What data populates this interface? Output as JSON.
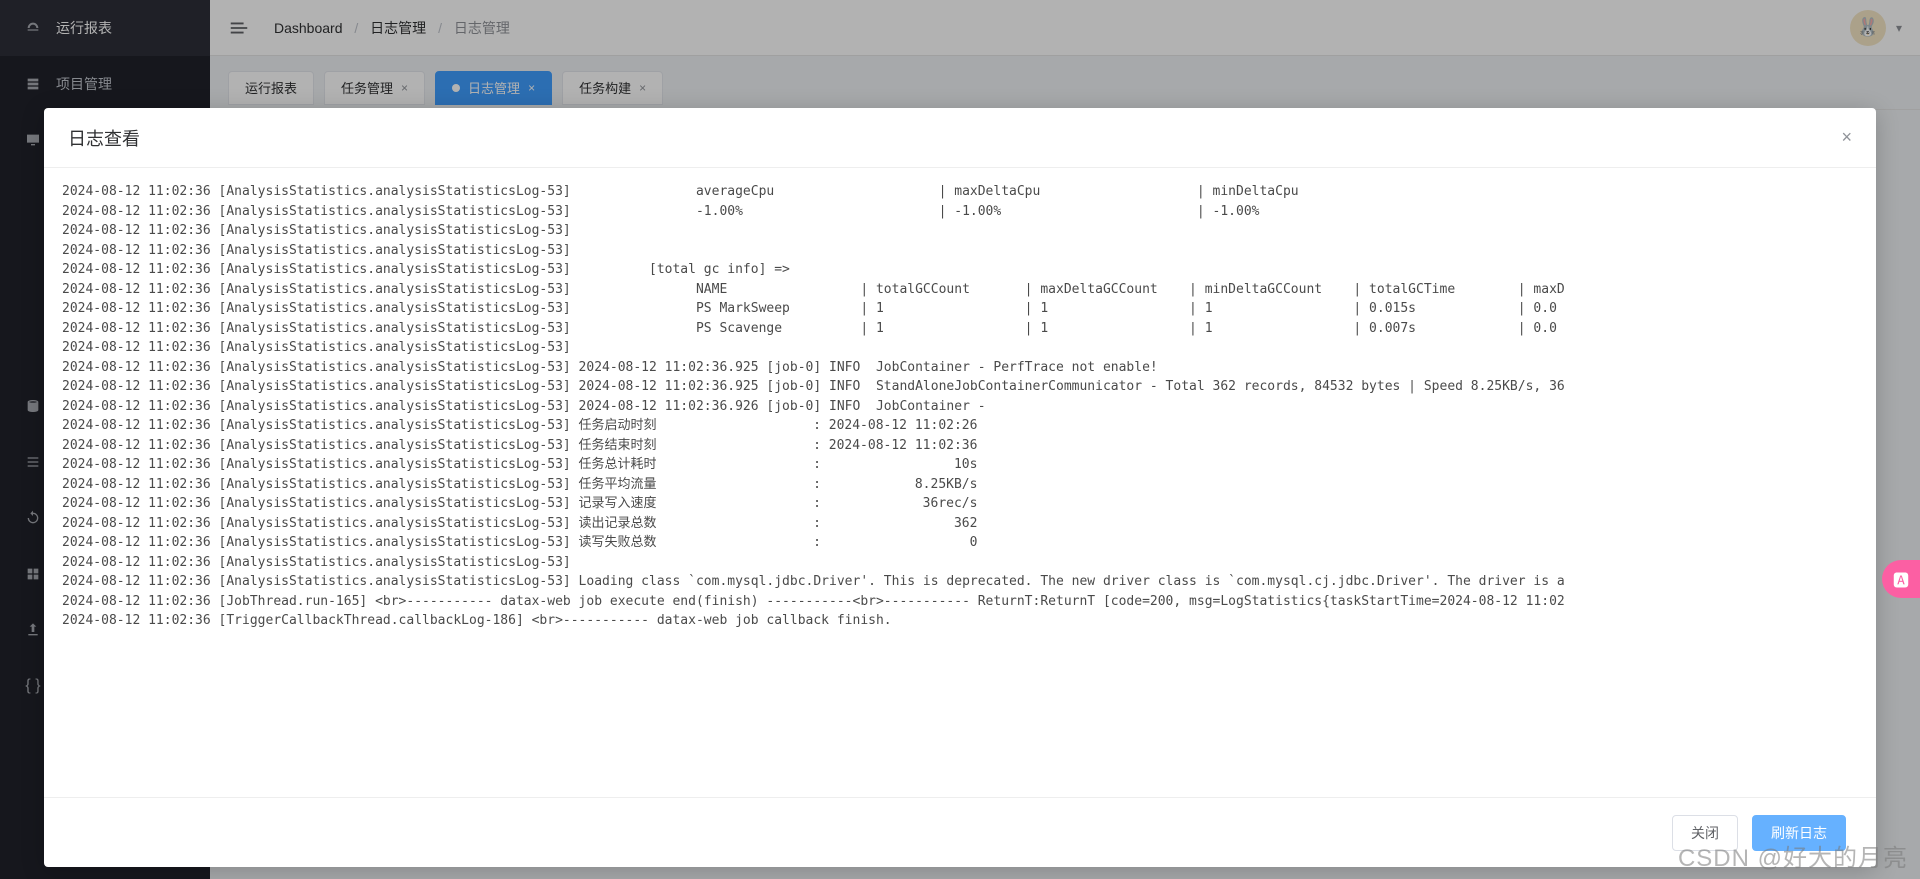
{
  "sidebar": {
    "items": [
      {
        "label": "运行报表",
        "icon": "dashboard-icon"
      },
      {
        "label": "项目管理",
        "icon": "project-icon"
      },
      {
        "label": "",
        "icon": "screen-icon"
      },
      {
        "label": "",
        "icon": "database-icon"
      },
      {
        "label": "",
        "icon": "list-icon"
      },
      {
        "label": "",
        "icon": "sync-icon"
      },
      {
        "label": "",
        "icon": "grid-icon"
      },
      {
        "label": "",
        "icon": "export-icon"
      },
      {
        "label": "",
        "icon": "braces-icon"
      }
    ]
  },
  "topbar": {
    "crumb1": "Dashboard",
    "crumb2": "日志管理",
    "crumb3": "日志管理",
    "avatar_glyph": "🐰"
  },
  "tabs": {
    "items": [
      {
        "label": "运行报表",
        "closable": false
      },
      {
        "label": "任务管理",
        "closable": true
      },
      {
        "label": "日志管理",
        "closable": true
      },
      {
        "label": "任务构建",
        "closable": true
      }
    ],
    "active_index": 2
  },
  "modal": {
    "title": "日志查看",
    "close_btn": "关闭",
    "refresh_btn": "刷新日志"
  },
  "log_lines": [
    "2024-08-12 11:02:36 [AnalysisStatistics.analysisStatisticsLog-53]                averageCpu                     | maxDeltaCpu                    | minDeltaCpu",
    "2024-08-12 11:02:36 [AnalysisStatistics.analysisStatisticsLog-53]                -1.00%                         | -1.00%                         | -1.00%",
    "2024-08-12 11:02:36 [AnalysisStatistics.analysisStatisticsLog-53] ",
    "2024-08-12 11:02:36 [AnalysisStatistics.analysisStatisticsLog-53] ",
    "2024-08-12 11:02:36 [AnalysisStatistics.analysisStatisticsLog-53]          [total gc info] =>",
    "2024-08-12 11:02:36 [AnalysisStatistics.analysisStatisticsLog-53]                NAME                 | totalGCCount       | maxDeltaGCCount    | minDeltaGCCount    | totalGCTime        | maxD",
    "2024-08-12 11:02:36 [AnalysisStatistics.analysisStatisticsLog-53]                PS MarkSweep         | 1                  | 1                  | 1                  | 0.015s             | 0.0",
    "2024-08-12 11:02:36 [AnalysisStatistics.analysisStatisticsLog-53]                PS Scavenge          | 1                  | 1                  | 1                  | 0.007s             | 0.0",
    "2024-08-12 11:02:36 [AnalysisStatistics.analysisStatisticsLog-53] ",
    "2024-08-12 11:02:36 [AnalysisStatistics.analysisStatisticsLog-53] 2024-08-12 11:02:36.925 [job-0] INFO  JobContainer - PerfTrace not enable!",
    "2024-08-12 11:02:36 [AnalysisStatistics.analysisStatisticsLog-53] 2024-08-12 11:02:36.925 [job-0] INFO  StandAloneJobContainerCommunicator - Total 362 records, 84532 bytes | Speed 8.25KB/s, 36",
    "2024-08-12 11:02:36 [AnalysisStatistics.analysisStatisticsLog-53] 2024-08-12 11:02:36.926 [job-0] INFO  JobContainer -",
    "2024-08-12 11:02:36 [AnalysisStatistics.analysisStatisticsLog-53] 任务启动时刻                    : 2024-08-12 11:02:26",
    "2024-08-12 11:02:36 [AnalysisStatistics.analysisStatisticsLog-53] 任务结束时刻                    : 2024-08-12 11:02:36",
    "2024-08-12 11:02:36 [AnalysisStatistics.analysisStatisticsLog-53] 任务总计耗时                    :                 10s",
    "2024-08-12 11:02:36 [AnalysisStatistics.analysisStatisticsLog-53] 任务平均流量                    :            8.25KB/s",
    "2024-08-12 11:02:36 [AnalysisStatistics.analysisStatisticsLog-53] 记录写入速度                    :             36rec/s",
    "2024-08-12 11:02:36 [AnalysisStatistics.analysisStatisticsLog-53] 读出记录总数                    :                 362",
    "2024-08-12 11:02:36 [AnalysisStatistics.analysisStatisticsLog-53] 读写失败总数                    :                   0",
    "2024-08-12 11:02:36 [AnalysisStatistics.analysisStatisticsLog-53] ",
    "2024-08-12 11:02:36 [AnalysisStatistics.analysisStatisticsLog-53] Loading class `com.mysql.jdbc.Driver'. This is deprecated. The new driver class is `com.mysql.cj.jdbc.Driver'. The driver is a",
    "2024-08-12 11:02:36 [JobThread.run-165] <br>----------- datax-web job execute end(finish) -----------<br>----------- ReturnT:ReturnT [code=200, msg=LogStatistics{taskStartTime=2024-08-12 11:02",
    "2024-08-12 11:02:36 [TriggerCallbackThread.callbackLog-186] <br>----------- datax-web job callback finish."
  ],
  "float_badge": "🅰",
  "watermark": "CSDN @好大的月亮"
}
